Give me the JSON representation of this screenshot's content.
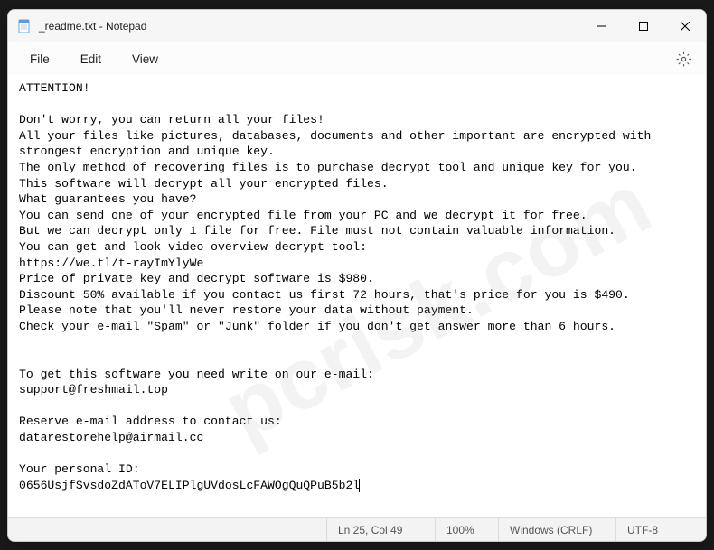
{
  "window": {
    "title": "_readme.txt - Notepad"
  },
  "menu": {
    "file": "File",
    "edit": "Edit",
    "view": "View"
  },
  "content": {
    "text": "ATTENTION!\n\nDon't worry, you can return all your files!\nAll your files like pictures, databases, documents and other important are encrypted with \nstrongest encryption and unique key.\nThe only method of recovering files is to purchase decrypt tool and unique key for you.\nThis software will decrypt all your encrypted files.\nWhat guarantees you have?\nYou can send one of your encrypted file from your PC and we decrypt it for free.\nBut we can decrypt only 1 file for free. File must not contain valuable information.\nYou can get and look video overview decrypt tool:\nhttps://we.tl/t-rayImYlyWe\nPrice of private key and decrypt software is $980.\nDiscount 50% available if you contact us first 72 hours, that's price for you is $490.\nPlease note that you'll never restore your data without payment.\nCheck your e-mail \"Spam\" or \"Junk\" folder if you don't get answer more than 6 hours.\n\n\nTo get this software you need write on our e-mail:\nsupport@freshmail.top\n\nReserve e-mail address to contact us:\ndatarestorehelp@airmail.cc\n\nYour personal ID:\n0656UsjfSvsdoZdAToV7ELIPlgUVdosLcFAWOgQuQPuB5b2l"
  },
  "status": {
    "position": "Ln 25, Col 49",
    "zoom": "100%",
    "line_ending": "Windows (CRLF)",
    "encoding": "UTF-8"
  },
  "watermark": "pcrisk.com"
}
